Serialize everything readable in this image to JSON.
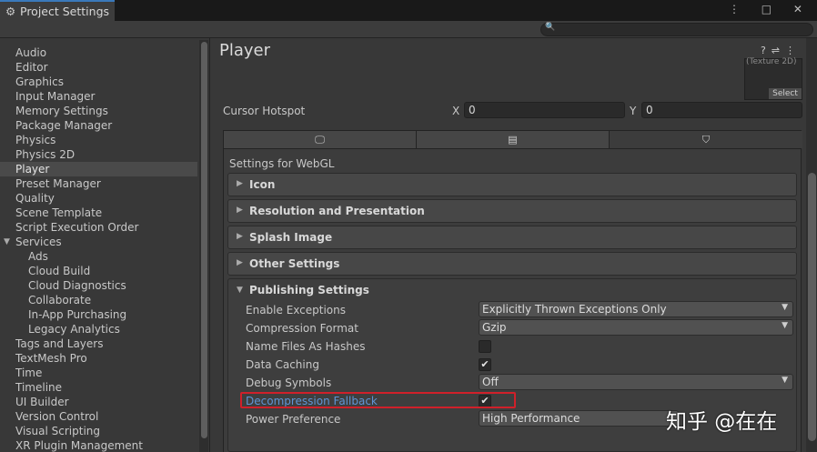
{
  "window": {
    "tab_title": "Project Settings",
    "tab_icon": "gear-icon",
    "controls": "⋮ □ ✕"
  },
  "sidebar": {
    "items": [
      {
        "label": "Audio"
      },
      {
        "label": "Editor"
      },
      {
        "label": "Graphics"
      },
      {
        "label": "Input Manager"
      },
      {
        "label": "Memory Settings"
      },
      {
        "label": "Package Manager"
      },
      {
        "label": "Physics"
      },
      {
        "label": "Physics 2D"
      },
      {
        "label": "Player"
      },
      {
        "label": "Preset Manager"
      },
      {
        "label": "Quality"
      },
      {
        "label": "Scene Template"
      },
      {
        "label": "Script Execution Order"
      },
      {
        "label": "Services"
      },
      {
        "label": "Ads"
      },
      {
        "label": "Cloud Build"
      },
      {
        "label": "Cloud Diagnostics"
      },
      {
        "label": "Collaborate"
      },
      {
        "label": "In-App Purchasing"
      },
      {
        "label": "Legacy Analytics"
      },
      {
        "label": "Tags and Layers"
      },
      {
        "label": "TextMesh Pro"
      },
      {
        "label": "Time"
      },
      {
        "label": "Timeline"
      },
      {
        "label": "UI Builder"
      },
      {
        "label": "Version Control"
      },
      {
        "label": "Visual Scripting"
      },
      {
        "label": "XR Plugin Management"
      }
    ],
    "selected": "Player"
  },
  "main": {
    "title": "Player",
    "texture_caption": "(Texture 2D)",
    "texture_select": "Select",
    "cursor_hotspot": {
      "label": "Cursor Hotspot",
      "x_label": "X",
      "x_value": "0",
      "y_label": "Y",
      "y_value": "0"
    },
    "platform_tabs": [
      "monitor-icon",
      "android-icon",
      "html5-icon"
    ],
    "settings_for": "Settings for WebGL",
    "sections": [
      {
        "label": "Icon"
      },
      {
        "label": "Resolution and Presentation"
      },
      {
        "label": "Splash Image"
      },
      {
        "label": "Other Settings"
      }
    ],
    "publishing": {
      "label": "Publishing Settings",
      "enable_exceptions": {
        "label": "Enable Exceptions",
        "value": "Explicitly Thrown Exceptions Only"
      },
      "compression_format": {
        "label": "Compression Format",
        "value": "Gzip"
      },
      "name_files_as_hashes": {
        "label": "Name Files As Hashes",
        "checked": false
      },
      "data_caching": {
        "label": "Data Caching",
        "checked": true
      },
      "debug_symbols": {
        "label": "Debug Symbols",
        "value": "Off"
      },
      "decompression_fallback": {
        "label": "Decompression Fallback",
        "checked": true
      },
      "power_preference": {
        "label": "Power Preference",
        "value": "High Performance"
      }
    }
  },
  "watermark": "知乎 @在在",
  "colors": {
    "accent": "#3a79bb",
    "highlight_box": "#d0202a",
    "link": "#5f95d6"
  }
}
